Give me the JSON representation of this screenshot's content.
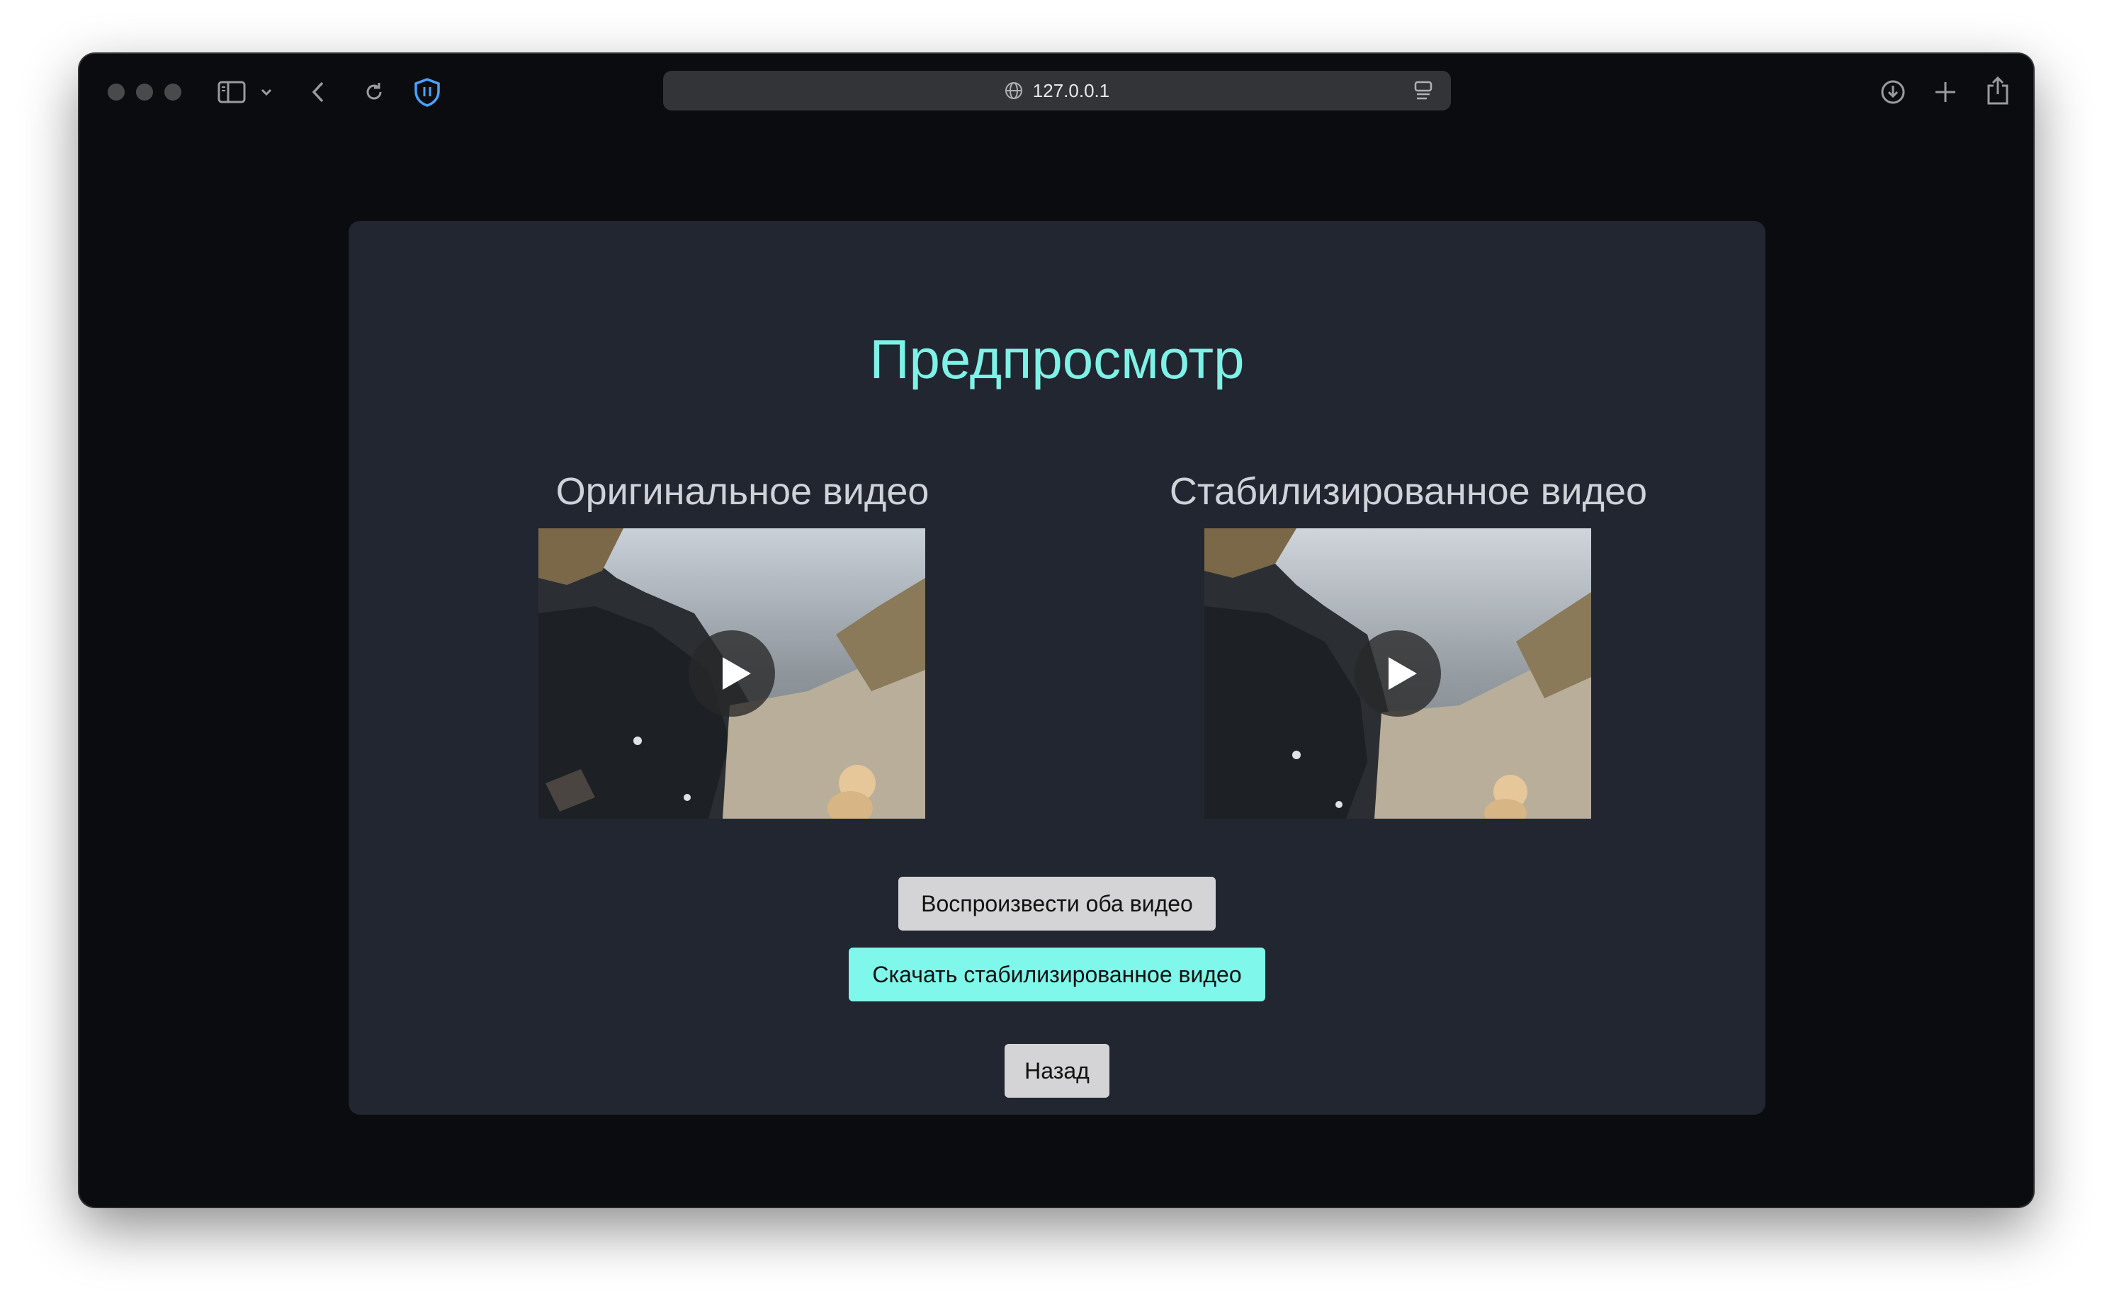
{
  "browser": {
    "url": "127.0.0.1",
    "icons": [
      "sidebar-icon",
      "chevron-down-icon",
      "back-icon",
      "reload-icon",
      "shield-icon",
      "globe-icon",
      "reader-icon",
      "download-icon",
      "plus-icon",
      "share-icon"
    ]
  },
  "page": {
    "title": "Предпросмотр",
    "original_label": "Оригинальное видео",
    "stabilized_label": "Стабилизированное видео",
    "play_both_label": "Воспроизвести оба видео",
    "download_label": "Скачать стабилизированное видео",
    "back_label": "Назад"
  },
  "colors": {
    "accent": "#7ef2e6",
    "card_bg": "#212631",
    "page_bg": "#0b0c10",
    "button_gray": "#d4d4d6",
    "button_cyan": "#7ff7ea"
  }
}
